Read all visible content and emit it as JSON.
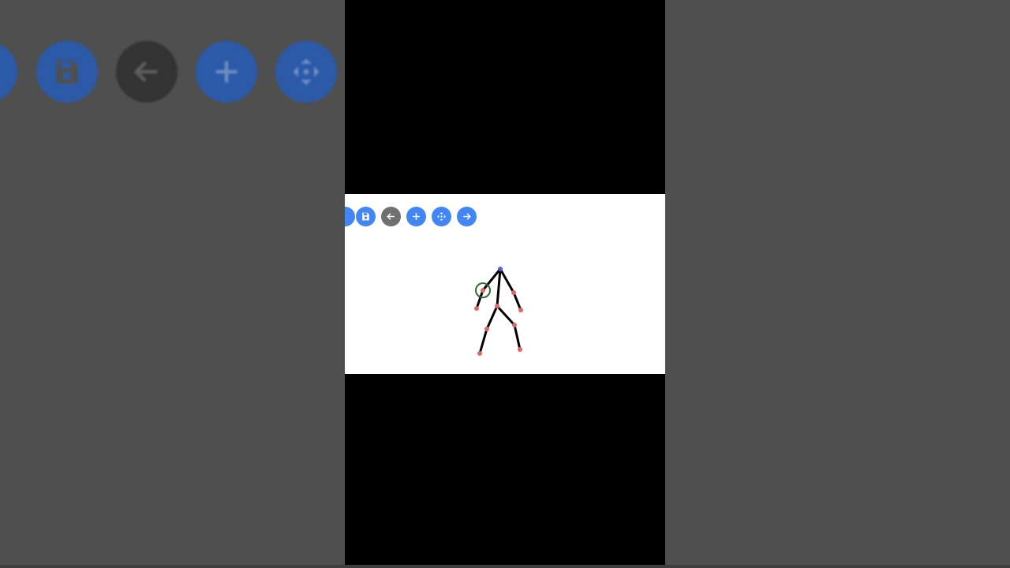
{
  "colors": {
    "backdrop": "#4f4f4f",
    "blue": "#4285f4",
    "blue_dim": "#2c5aa8",
    "gray": "#707070",
    "gray_dim": "#333333",
    "joint": "#e06666",
    "head": "#5b5bd6",
    "selection_ring": "#2e6b2e"
  },
  "toolbar": {
    "buttons": [
      {
        "name": "partial-button",
        "icon": "circle-icon",
        "color": "blue"
      },
      {
        "name": "save-button",
        "icon": "save-icon",
        "color": "blue"
      },
      {
        "name": "undo-button",
        "icon": "arrow-left-icon",
        "color": "gray"
      },
      {
        "name": "add-button",
        "icon": "plus-icon",
        "color": "blue"
      },
      {
        "name": "move-button",
        "icon": "move-icon",
        "color": "blue"
      },
      {
        "name": "next-button",
        "icon": "arrow-right-icon",
        "color": "blue"
      }
    ]
  },
  "figure": {
    "selected_joint": "left-elbow"
  }
}
